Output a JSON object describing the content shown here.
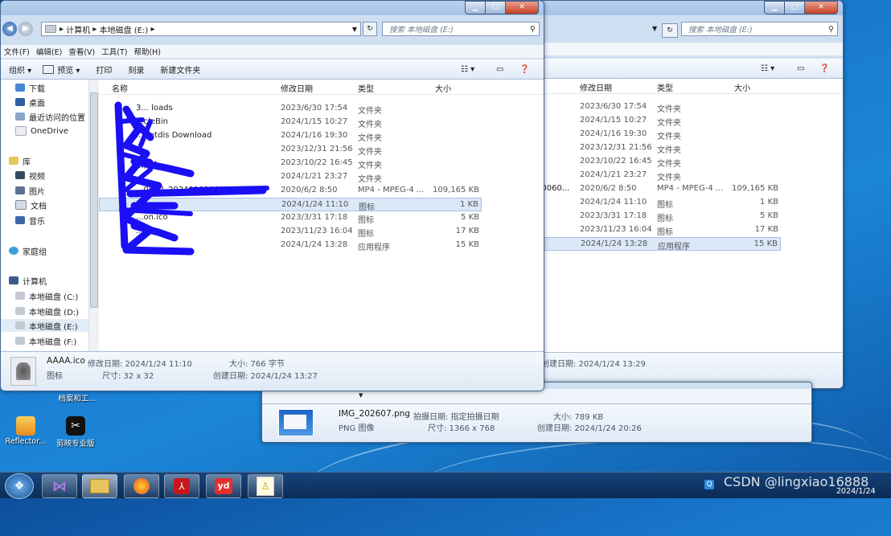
{
  "back_window": {
    "address_label": "",
    "search_placeholder": "搜索 本地磁盘 (E:)",
    "columns": [
      "修改日期",
      "类型",
      "大小"
    ],
    "rows": [
      {
        "name_fragment": "",
        "date": "2023/6/30 17:54",
        "type": "文件夹",
        "size": ""
      },
      {
        "name_fragment": "",
        "date": "2024/1/15 10:27",
        "type": "文件夹",
        "size": ""
      },
      {
        "name_fragment": "",
        "date": "2024/1/16 19:30",
        "type": "文件夹",
        "size": ""
      },
      {
        "name_fragment": "",
        "date": "2023/12/31 21:56",
        "type": "文件夹",
        "size": ""
      },
      {
        "name_fragment": "",
        "date": "2023/10/22 16:45",
        "type": "文件夹",
        "size": ""
      },
      {
        "name_fragment": "",
        "date": "2024/1/21 23:27",
        "type": "文件夹",
        "size": ""
      },
      {
        "name_fragment": "00060...",
        "date": "2020/6/2 8:50",
        "type": "MP4 - MPEG-4 ...",
        "size": "109,165 KB"
      },
      {
        "name_fragment": "",
        "date": "2024/1/24 11:10",
        "type": "图标",
        "size": "1 KB"
      },
      {
        "name_fragment": "",
        "date": "2023/3/31 17:18",
        "type": "图标",
        "size": "5 KB"
      },
      {
        "name_fragment": "",
        "date": "2023/11/23 16:04",
        "type": "图标",
        "size": "17 KB"
      },
      {
        "name_fragment": "",
        "date": "2024/1/24 13:28",
        "type": "应用程序",
        "size": "15 KB"
      }
    ],
    "details_created": "创建日期: 2024/1/24 13:29"
  },
  "image_window": {
    "filename": "IMG_202607.png",
    "filetype": "PNG 图像",
    "taken_label": "拍摄日期: 指定拍摄日期",
    "dimensions": "尺寸: 1366 x 768",
    "size": "大小: 789 KB",
    "created": "创建日期: 2024/1/24 20:26"
  },
  "front_window": {
    "breadcrumb": [
      "计算机",
      "本地磁盘 (E:)"
    ],
    "search_placeholder": "搜索 本地磁盘 (E:)",
    "menu": [
      "文件(F)",
      "编辑(E)",
      "查看(V)",
      "工具(T)",
      "帮助(H)"
    ],
    "toolbar": {
      "organize": "组织 ▾",
      "preview": "预览 ▾",
      "print": "打印",
      "burn": "刻录",
      "new_folder": "新建文件夹"
    },
    "nav": {
      "downloads": "下载",
      "desktop": "桌面",
      "recent": "最近访问的位置",
      "onedrive": "OneDrive",
      "libraries": "库",
      "videos": "视频",
      "pictures": "图片",
      "documents": "文档",
      "music": "音乐",
      "homegroup": "家庭组",
      "computer": "计算机",
      "drive_c": "本地磁盘 (C:)",
      "drive_d": "本地磁盘 (D:)",
      "drive_e": "本地磁盘 (E:)",
      "drive_f": "本地磁盘 (F:)"
    },
    "columns": {
      "name": "名称",
      "date": "修改日期",
      "type": "类型",
      "size": "大小"
    },
    "rows": [
      {
        "name": "3... loads",
        "date": "2023/6/30 17:54",
        "type": "文件夹",
        "size": ""
      },
      {
        "name": "...cleBin",
        "date": "2024/1/15 10:27",
        "type": "文件夹",
        "size": ""
      },
      {
        "name": "...Netdis Download",
        "date": "2024/1/16 19:30",
        "type": "文件夹",
        "size": ""
      },
      {
        "name": "",
        "date": "2023/12/31 21:56",
        "type": "文件夹",
        "size": ""
      },
      {
        "name": "...集合",
        "date": "2023/10/22 16:45",
        "type": "文件夹",
        "size": ""
      },
      {
        "name": "",
        "date": "2024/1/21 23:27",
        "type": "文件夹",
        "size": ""
      },
      {
        "name": "...0602_20240101000...",
        "date": "2020/6/2 8:50",
        "type": "MP4 - MPEG-4 ...",
        "size": "109,165 KB"
      },
      {
        "name": "...ico",
        "date": "2024/1/24 11:10",
        "type": "图标",
        "size": "1 KB"
      },
      {
        "name": "...on.ico",
        "date": "2023/3/31 17:18",
        "type": "图标",
        "size": "5 KB"
      },
      {
        "name": "...co",
        "date": "2023/11/23 16:04",
        "type": "图标",
        "size": "17 KB"
      },
      {
        "name": "",
        "date": "2024/1/24 13:28",
        "type": "应用程序",
        "size": "15 KB"
      }
    ],
    "details": {
      "filename": "AAAA.ico",
      "filetype": "图标",
      "modified": "修改日期: 2024/1/24 11:10",
      "dimensions": "尺寸: 32 x 32",
      "size": "大小: 766 字节",
      "created": "创建日期: 2024/1/24 13:27"
    }
  },
  "desktop": {
    "icon1": "Reflector...",
    "icon2": "剪映专业版",
    "partial_label": "档案和工..."
  },
  "taskbar": {
    "watermark": "CSDN @lingxiao16888",
    "tray_time": "",
    "tray_date": "2024/1/24"
  },
  "colors": {
    "selection": "#dbe8f7",
    "titlebar": "#a6c3e8",
    "desktop": "#1877cc",
    "redaction": "#1a0ff5"
  }
}
